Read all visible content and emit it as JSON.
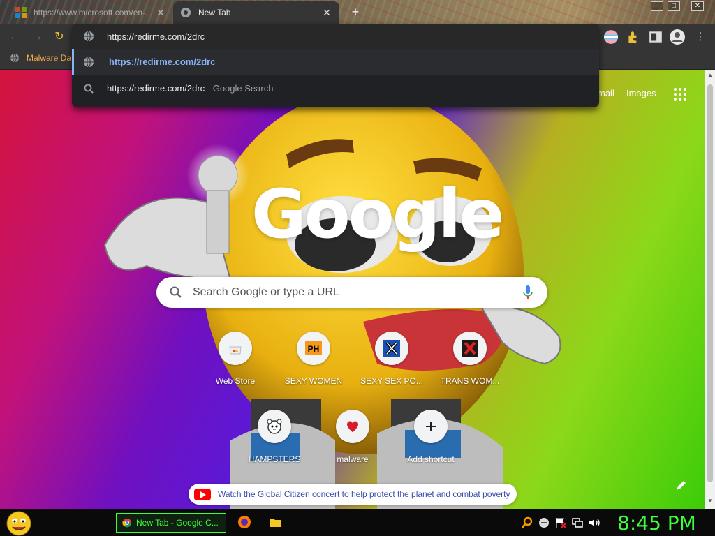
{
  "tabs": [
    {
      "title": "https://www.microsoft.com/en-...",
      "close": "✕"
    },
    {
      "title": "New Tab",
      "close": "✕"
    }
  ],
  "new_tab_symbol": "+",
  "window_controls": {
    "minimize": "–",
    "maximize": "□",
    "close": "✕"
  },
  "toolbar": {
    "back": "←",
    "forward": "→",
    "reload": "↻",
    "icons": [
      "profile-flag-icon",
      "extensions-icon",
      "sidebar-icon",
      "account-icon",
      "menu-icon"
    ],
    "menu_symbol": "⋮"
  },
  "bookmarks": [
    {
      "label": "Malware Da",
      "icon": "globe-icon"
    }
  ],
  "omnibox": {
    "value": "https://redirme.com/2drc",
    "suggestions": [
      {
        "text": "https://redirme.com/2drc",
        "suffix": "",
        "icon": "globe-icon"
      },
      {
        "text": "https://redirme.com/2drc",
        "suffix": " - Google Search",
        "icon": "search-icon"
      }
    ]
  },
  "ntp": {
    "links": {
      "gmail": "mail",
      "images": "Images"
    },
    "logo": "Google",
    "search_placeholder": "Search Google or type a URL",
    "shortcuts": [
      {
        "label": "Web Store",
        "icon": "web-store-icon"
      },
      {
        "label": "SEXY WOMEN",
        "icon": "ph-icon"
      },
      {
        "label": "SEXY SEX PO...",
        "icon": "x-blue-icon"
      },
      {
        "label": "TRANS WOM...",
        "icon": "x-red-icon"
      },
      {
        "label": "HAMPSTERS",
        "icon": "hamster-icon"
      },
      {
        "label": "malware",
        "icon": "heart-icon"
      },
      {
        "label": "Add shortcut",
        "icon": "plus-icon"
      }
    ],
    "promo": "Watch the Global Citizen concert to help protect the planet and combat poverty",
    "colors": {
      "accent_link": "#8ab4f8",
      "youtube_red": "#ff0000"
    }
  },
  "taskbar": {
    "task": "New Tab - Google C...",
    "clock": "8:45 PM",
    "clock_color": "#3cff3c"
  }
}
